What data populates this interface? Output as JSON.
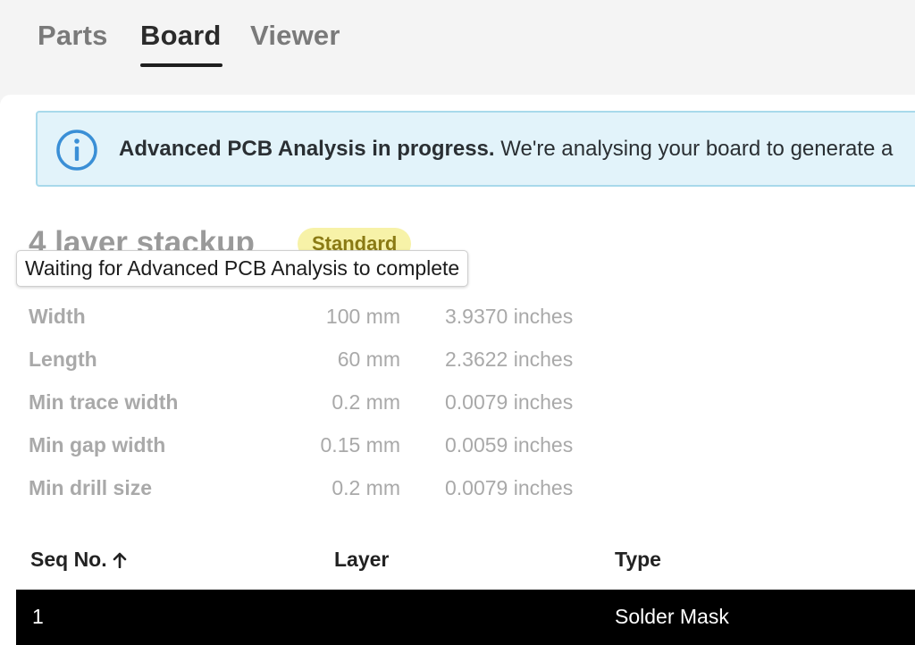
{
  "tabs": [
    {
      "label": "Parts",
      "active": false
    },
    {
      "label": "Board",
      "active": true
    },
    {
      "label": "Viewer",
      "active": false
    }
  ],
  "banner": {
    "icon": "info-icon",
    "bold_text": "Advanced PCB Analysis in progress.",
    "text": "We're analysing your board to generate a"
  },
  "stackup": {
    "title": "4 layer stackup",
    "badge": "Standard"
  },
  "tooltip": {
    "text": "Waiting for Advanced PCB Analysis to complete"
  },
  "specs": [
    {
      "label": "Width",
      "mm": "100 mm",
      "inches": "3.9370 inches"
    },
    {
      "label": "Length",
      "mm": "60 mm",
      "inches": "2.3622 inches"
    },
    {
      "label": "Min trace width",
      "mm": "0.2 mm",
      "inches": "0.0079 inches"
    },
    {
      "label": "Min gap width",
      "mm": "0.15 mm",
      "inches": "0.0059 inches"
    },
    {
      "label": "Min drill size",
      "mm": "0.2 mm",
      "inches": "0.0079 inches"
    }
  ],
  "table": {
    "headers": {
      "seq": "Seq No.",
      "layer": "Layer",
      "type": "Type"
    },
    "sort_icon": "arrow-up-icon",
    "rows": [
      {
        "seq": "1",
        "layer": "",
        "type": "Solder Mask"
      }
    ]
  },
  "colors": {
    "banner_bg": "#e2f3fa",
    "banner_border": "#a8d9eb",
    "info_icon": "#3a8fd6",
    "badge_bg": "#f7f2a8",
    "selected_row": "#000000"
  }
}
